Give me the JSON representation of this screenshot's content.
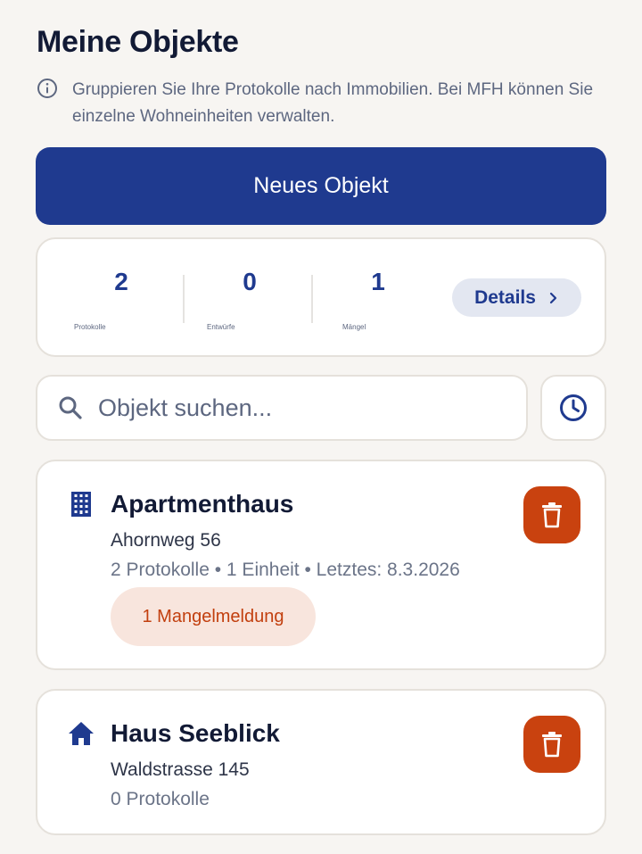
{
  "header": {
    "title": "Meine Objekte",
    "info_text": "Gruppieren Sie Ihre Protokolle nach Immobilien. Bei MFH können Sie einzelne Wohneinheiten verwalten.",
    "info_icon": "info-circle-icon"
  },
  "actions": {
    "new_object_label": "Neues Objekt"
  },
  "stats": {
    "protokolle": {
      "value": "2",
      "label": "Protokolle"
    },
    "entwuerfe": {
      "value": "0",
      "label": "Entwürfe"
    },
    "maengel": {
      "value": "1",
      "label": "Mängel"
    },
    "details_label": "Details"
  },
  "search": {
    "placeholder": "Objekt suchen...",
    "value": ""
  },
  "objects": [
    {
      "icon": "apartment-building-icon",
      "title": "Apartmenthaus",
      "address": "Ahornweg 56",
      "meta": "2 Protokolle • 1 Einheit • Letztes: 8.3.2026",
      "badge": "1 Mangelmeldung"
    },
    {
      "icon": "house-icon",
      "title": "Haus Seeblick",
      "address": "Waldstrasse 145",
      "meta": "0 Protokolle"
    }
  ],
  "colors": {
    "primary": "#1f3a8f",
    "danger": "#c9420f",
    "badge_bg": "#f8e5dd",
    "badge_text": "#c23f0e",
    "background": "#f7f5f2"
  }
}
